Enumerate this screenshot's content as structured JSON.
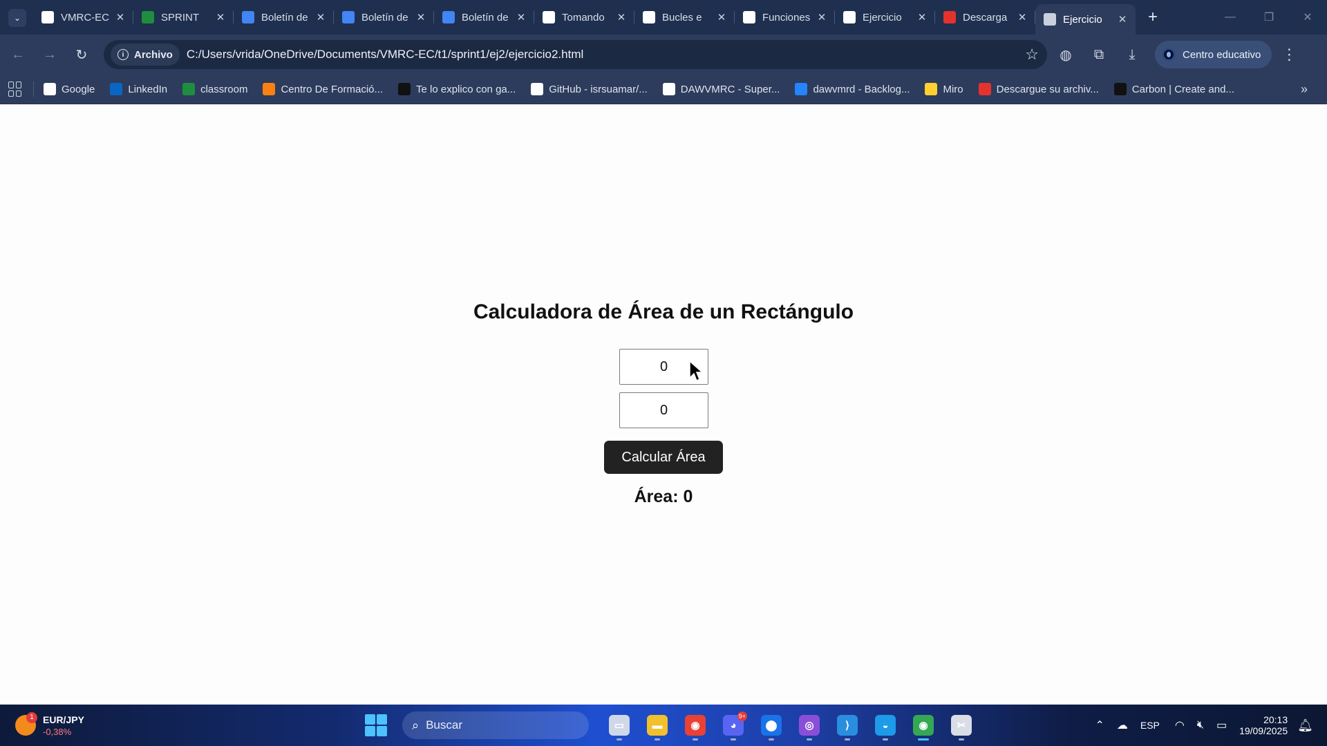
{
  "browser": {
    "tabs": [
      {
        "title": "VMRC-EC",
        "icon": "github-icon",
        "color": "#ffffff"
      },
      {
        "title": "SPRINT",
        "icon": "classroom-icon",
        "color": "#1e8e3e"
      },
      {
        "title": "Boletín de",
        "icon": "docs-icon",
        "color": "#4285f4"
      },
      {
        "title": "Boletín de",
        "icon": "docs-icon",
        "color": "#4285f4"
      },
      {
        "title": "Boletín de",
        "icon": "docs-icon",
        "color": "#4285f4"
      },
      {
        "title": "Tomando",
        "icon": "medium-icon",
        "color": "#ffffff"
      },
      {
        "title": "Bucles e",
        "icon": "medium-icon",
        "color": "#ffffff"
      },
      {
        "title": "Funciones",
        "icon": "medium-icon",
        "color": "#ffffff"
      },
      {
        "title": "Ejercicio",
        "icon": "openai-icon",
        "color": "#ffffff"
      },
      {
        "title": "Descarga",
        "icon": "ilovepdf-icon",
        "color": "#e5322d"
      },
      {
        "title": "Ejercicio",
        "icon": "globe-icon",
        "color": "#c9d1df",
        "active": true
      }
    ],
    "address": {
      "chip_label": "Archivo",
      "url": "C:/Users/vrida/OneDrive/Documents/VMRC-EC/t1/sprint1/ej2/ejercicio2.html"
    },
    "profile_label": "Centro educativo",
    "bookmarks": [
      {
        "label": "Google",
        "icon": "google-icon",
        "color": "#ffffff"
      },
      {
        "label": "LinkedIn",
        "icon": "linkedin-icon",
        "color": "#0a66c2"
      },
      {
        "label": "classroom",
        "icon": "classroom-icon",
        "color": "#1e8e3e"
      },
      {
        "label": "Centro De Formació...",
        "icon": "moodle-icon",
        "color": "#f98012"
      },
      {
        "label": "Te lo explico con ga...",
        "icon": "folder-dark-icon",
        "color": "#111111"
      },
      {
        "label": "GitHub - isrsuamar/...",
        "icon": "github-icon",
        "color": "#ffffff"
      },
      {
        "label": "DAWVMRC - Super...",
        "icon": "trello-icon",
        "color": "#ffffff"
      },
      {
        "label": "dawvmrd - Backlog...",
        "icon": "jira-icon",
        "color": "#2684ff"
      },
      {
        "label": "Miro",
        "icon": "miro-icon",
        "color": "#ffd02f"
      },
      {
        "label": "Descargue su archiv...",
        "icon": "ilovepdf-icon",
        "color": "#e5322d"
      },
      {
        "label": "Carbon | Create and...",
        "icon": "carbon-icon",
        "color": "#111111"
      }
    ]
  },
  "page": {
    "title": "Calculadora de Área de un Rectángulo",
    "width_value": "0",
    "height_value": "0",
    "button_label": "Calcular Área",
    "result_text": "Área: 0"
  },
  "taskbar": {
    "widget": {
      "ticker": "EUR/JPY",
      "change": "-0,38%",
      "badge": "1"
    },
    "search_placeholder": "Buscar",
    "apps": [
      {
        "name": "task-view-icon",
        "color": "#cfd8e8",
        "glyph": "▭"
      },
      {
        "name": "file-explorer-icon",
        "color": "#f2c02c",
        "glyph": "▬"
      },
      {
        "name": "chrome-icon",
        "color": "#e94235",
        "glyph": "◉"
      },
      {
        "name": "discord-icon",
        "color": "#5865f2",
        "glyph": "◕",
        "badge": "9+"
      },
      {
        "name": "maps-icon",
        "color": "#1a73e8",
        "glyph": "⬤"
      },
      {
        "name": "github-desktop-icon",
        "color": "#8a4fd8",
        "glyph": "◎"
      },
      {
        "name": "vscode-icon",
        "color": "#2a8ee0",
        "glyph": "⟩"
      },
      {
        "name": "docker-icon",
        "color": "#1d9ae8",
        "glyph": "◒"
      },
      {
        "name": "chrome-profile-icon",
        "color": "#34a853",
        "glyph": "◉",
        "active": true
      },
      {
        "name": "snipping-tool-icon",
        "color": "#d9dde6",
        "glyph": "✂"
      }
    ],
    "language": "ESP",
    "time": "20:13",
    "date": "19/09/2025"
  }
}
